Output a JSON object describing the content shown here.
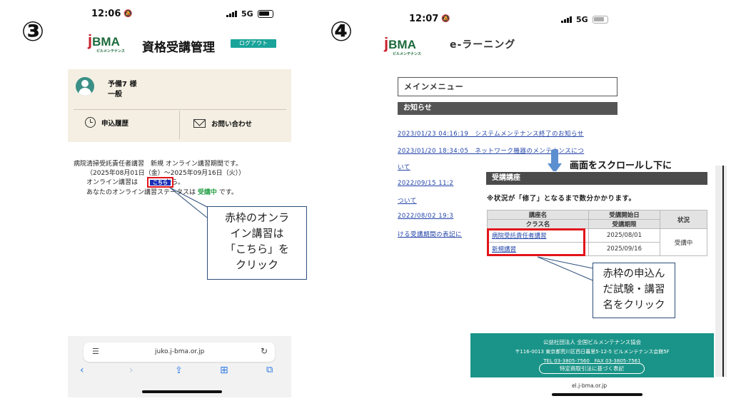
{
  "steps": {
    "left": "③",
    "right": "④"
  },
  "phone1": {
    "status": {
      "time": "12:06",
      "network": "5G"
    },
    "header": {
      "title": "資格受講管理",
      "logout_label": "ログアウト",
      "logo_text": "BMA",
      "logo_j": "j",
      "logo_sub": "ビルメンテナンス"
    },
    "user": {
      "name": "予備7 様",
      "type": "一般"
    },
    "menu": {
      "history": "申込履歴",
      "contact": "お問い合わせ"
    },
    "content": {
      "line1": "病院清掃受託責任者講習　新規 オンライン講習期間です。",
      "line2": "（2025年08月01日（金）～2025年09月16日（火））",
      "line3_pre": "オンライン講習は",
      "link_label": "こちら",
      "line3_post": "から。",
      "line4_pre": "あなたのオンライン講習ステータスは",
      "status": "受講中",
      "line4_post": "です。"
    },
    "callout": [
      "赤枠のオンラ",
      "イン講習は",
      "「こちら」を",
      "クリック"
    ],
    "browser": {
      "url": "juko.j-bma.or.jp"
    },
    "colors": {
      "accent": "#1aa39a",
      "red": "#e2141a",
      "link": "#1c2fb8"
    }
  },
  "phone2": {
    "status": {
      "time": "12:07",
      "network": "5G"
    },
    "header": {
      "title": "e-ラーニング",
      "logo_text": "BMA",
      "logo_j": "j",
      "logo_sub": "ビルメンテナンス"
    },
    "main_menu": "メインメニュー",
    "news_title": "お知らせ",
    "news": [
      "2023/01/23 04:16:19　システムメンテナンス終了のお知らせ",
      "2023/01/20 18:34:05　ネットワーク機器のメンテナンスにつ",
      "いて",
      "2022/09/15 11:2",
      "ついて",
      "2022/08/02 19:3",
      "ける受講期間の表記に"
    ],
    "scroll_label": "画面をスクロールし下に",
    "course": {
      "title": "受講講座",
      "note": "※状況が「修了」となるまで数分かかります。",
      "headers": {
        "course_name": "講座名",
        "start_date": "受講開始日",
        "class_name": "クラス名",
        "deadline": "受講期限",
        "status": "状況"
      },
      "row": {
        "course_name": "病院受託責任者講習",
        "class_name": "新規講習",
        "start_date": "2025/08/01",
        "deadline": "2025/09/16",
        "status": "受講中"
      }
    },
    "callout": [
      "赤枠の申込ん",
      "だ試験・講習",
      "名をクリック"
    ],
    "footer": {
      "org": "公益社団法人 全国ビルメンテナンス協会",
      "address": "〒116-0013 東京都荒川区西日暮里5-12-5 ビルメンテナンス会館5F",
      "tel": "TEL 03-3805-7560　FAX 03-3805-7561",
      "button": "特定商取引法に基づく表記"
    },
    "url": "el.j-bma.or.jp",
    "colors": {
      "footer": "#1a9488",
      "red": "#e2141a",
      "arrow": "#5b8fd0"
    }
  }
}
